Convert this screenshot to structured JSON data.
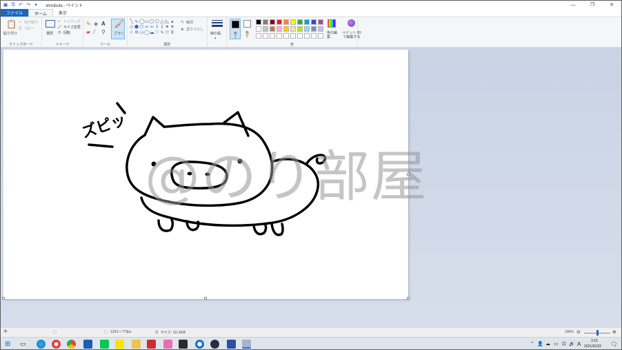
{
  "window": {
    "title": "shirobuta - ペイント",
    "quick_access": [
      "save-icon",
      "undo-icon",
      "redo-icon",
      "customize-icon"
    ],
    "controls": [
      "minimize",
      "maximize",
      "close"
    ],
    "min_glyph": "—",
    "max_glyph": "❐",
    "close_glyph": "✕"
  },
  "menu": {
    "file": "ファイル",
    "home": "ホーム",
    "view": "表示"
  },
  "ribbon": {
    "clipboard": {
      "paste": "貼り付け",
      "cut": "切り取り",
      "copy": "コピー",
      "label": "クリップボード"
    },
    "image": {
      "select": "選択",
      "crop": "トリミング",
      "resize": "サイズ変更",
      "rotate": "回転",
      "label": "イメージ"
    },
    "tools": {
      "brush": "ブラシ",
      "label": "ツール"
    },
    "shapes": {
      "outline": "輪郭",
      "fill": "塗りつぶし",
      "label": "図形"
    },
    "size": {
      "label": "線の幅"
    },
    "colors": {
      "color1": "色",
      "color1_num": "1",
      "color2": "色",
      "color2_num": "2",
      "edit": "色の編集",
      "paint3d": "ペイント 3D で編集する",
      "label": "色",
      "palette_row1": [
        "#000000",
        "#7f7f7f",
        "#880015",
        "#ed1c24",
        "#ff7f27",
        "#fff200",
        "#22b14c",
        "#00a2e8",
        "#3f48cc",
        "#a349a4"
      ],
      "palette_row2": [
        "#ffffff",
        "#c3c3c3",
        "#b97a57",
        "#ffaec9",
        "#ffc90e",
        "#efe4b0",
        "#b5e61d",
        "#99d9ea",
        "#7092be",
        "#c8bfe7"
      ],
      "palette_row3": [
        "#ffffff",
        "#ffffff",
        "#ffffff",
        "#ffffff",
        "#ffffff",
        "#ffffff",
        "#ffffff",
        "#ffffff",
        "#ffffff",
        "#ffffff"
      ],
      "active_color1": "#000000",
      "active_color2": "#ffffff"
    }
  },
  "canvas": {
    "drawing_text": "ズピッ",
    "watermark": "@のり部屋"
  },
  "status": {
    "dimensions": "1253 × 773px",
    "size": "サイズ: 111.6KB",
    "zoom": "100%",
    "zoom_level": 0.5
  },
  "taskbar": {
    "time": "3:15",
    "date": "2021/02/22",
    "ime": "A"
  }
}
